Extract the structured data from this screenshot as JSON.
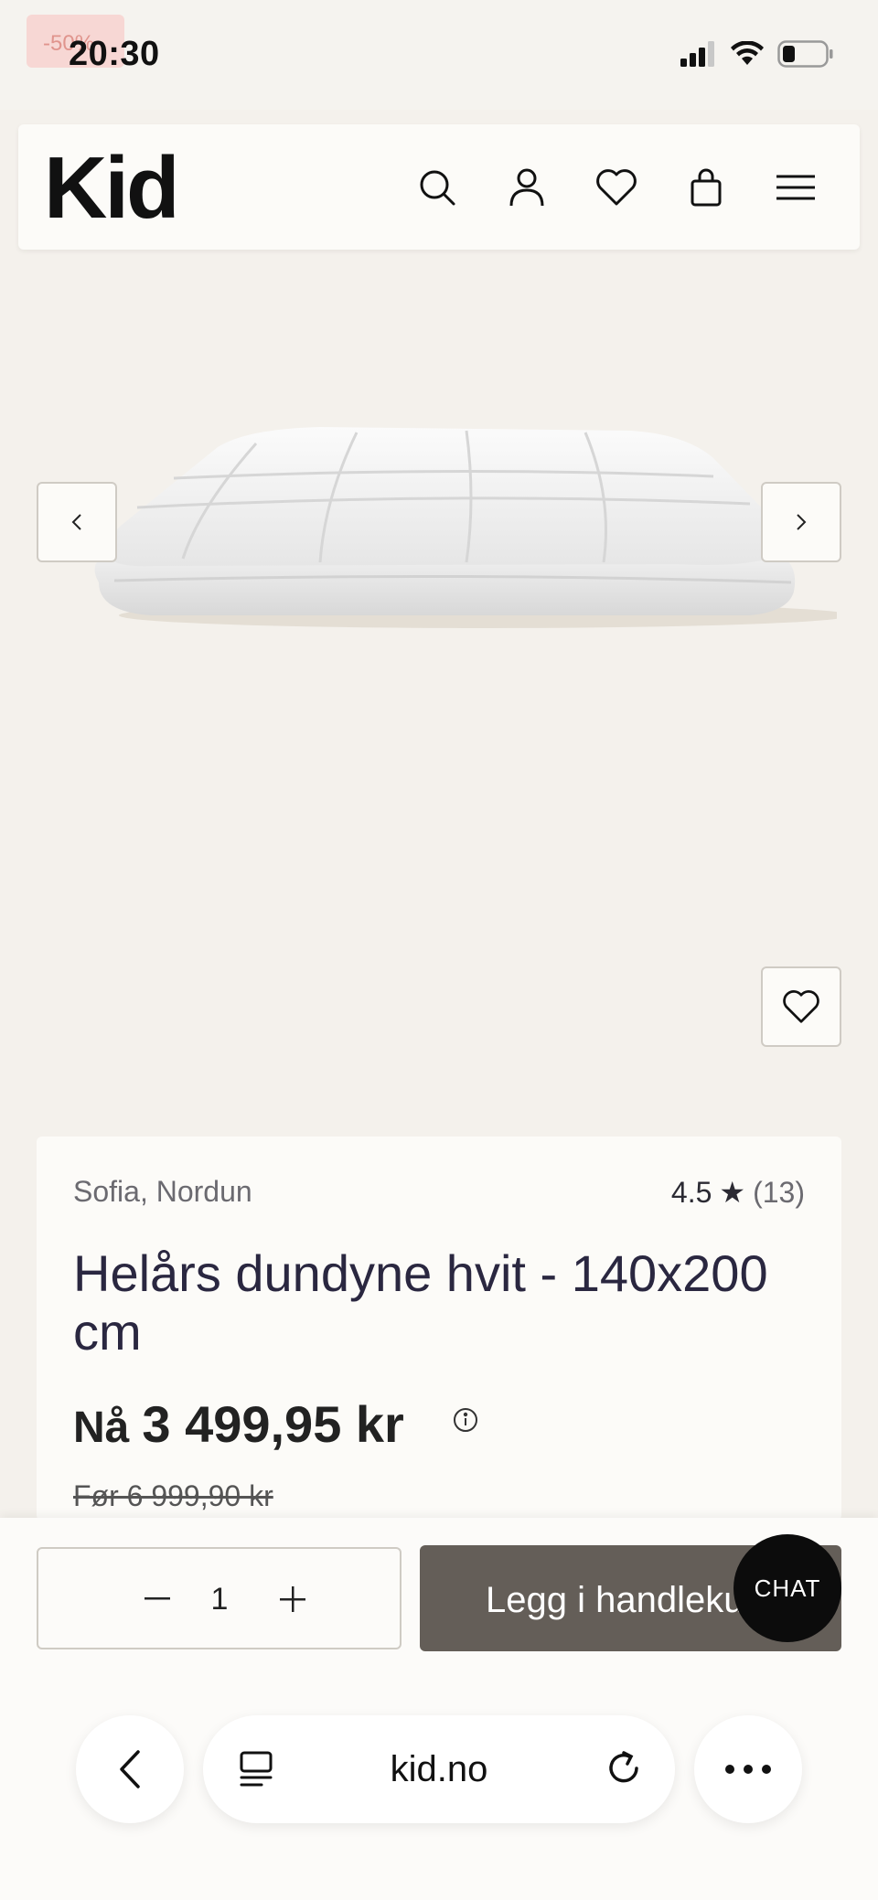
{
  "status_bar": {
    "time": "20:30",
    "badge": "-50%",
    "icons": [
      "signal-icon",
      "wifi-icon",
      "battery-icon"
    ]
  },
  "header": {
    "logo": "Kid",
    "icons": [
      "search-icon",
      "account-icon",
      "wishlist-icon",
      "cart-icon",
      "menu-icon"
    ]
  },
  "gallery": {
    "image_alt": "white down duvet",
    "prev_icon": "chevron-left-icon",
    "next_icon": "chevron-right-icon",
    "favorite_icon": "heart-icon"
  },
  "product": {
    "brand": "Sofia, Nordun",
    "rating": "4.5",
    "rating_star": "★",
    "review_count": "(13)",
    "title": "Helårs dundyne hvit - 140x200 cm",
    "price_label": "Nå",
    "price": "3 499,95 kr",
    "before_price": "Før 6 999,90 kr"
  },
  "cart": {
    "quantity": "1",
    "minus_icon": "minus-icon",
    "plus_icon": "plus-icon",
    "add_label": "Legg i handlekurv",
    "chat_label": "CHAT"
  },
  "browser": {
    "url": "kid.no",
    "icons": [
      "back-icon",
      "tabs-icon",
      "reload-icon",
      "more-icon"
    ]
  },
  "colors": {
    "page_bg": "#f4f1ec",
    "card_bg": "#fcfbf8",
    "add_button": "#645e58",
    "chat_button": "#0c0c0c",
    "title_text": "#2a2740"
  }
}
